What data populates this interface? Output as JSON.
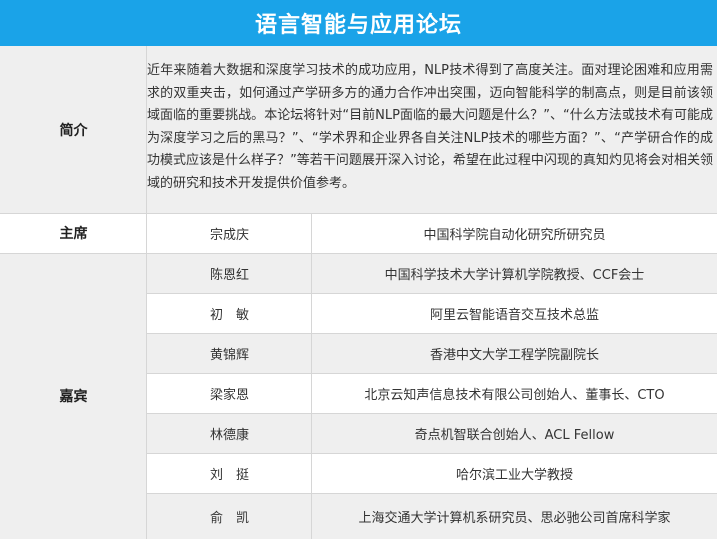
{
  "title": "语言智能与应用论坛",
  "intro": {
    "label": "简介",
    "text": "近年来随着大数据和深度学习技术的成功应用，NLP技术得到了高度关注。面对理论困难和应用需求的双重夹击，如何通过产学研多方的通力合作冲出突围，迈向智能科学的制高点，则是目前该领域面临的重要挑战。本论坛将针对“目前NLP面临的最大问题是什么？”、“什么方法或技术有可能成为深度学习之后的黑马？”、“学术界和企业界各自关注NLP技术的哪些方面？”、“产学研合作的成功模式应该是什么样子？”等若干问题展开深入讨论，希望在此过程中闪现的真知灼见将会对相关领域的研究和技术开发提供价值参考。"
  },
  "chair": {
    "label": "主席",
    "name": "宗成庆",
    "title": "中国科学院自动化研究所研究员"
  },
  "guests": {
    "label": "嘉宾",
    "rows": [
      {
        "name": "陈恩红",
        "title": "中国科学技术大学计算机学院教授、CCF会士"
      },
      {
        "name": "初　敏",
        "title": "阿里云智能语音交互技术总监"
      },
      {
        "name": "黄锦辉",
        "title": "香港中文大学工程学院副院长"
      },
      {
        "name": "梁家恩",
        "title": "北京云知声信息技术有限公司创始人、董事长、CTO"
      },
      {
        "name": "林德康",
        "title": "奇点机智联合创始人、ACL Fellow"
      },
      {
        "name": "刘　挺",
        "title": "哈尔滨工业大学教授"
      },
      {
        "name": "俞　凯",
        "title": "上海交通大学计算机系研究员、思必驰公司首席科学家"
      }
    ]
  }
}
